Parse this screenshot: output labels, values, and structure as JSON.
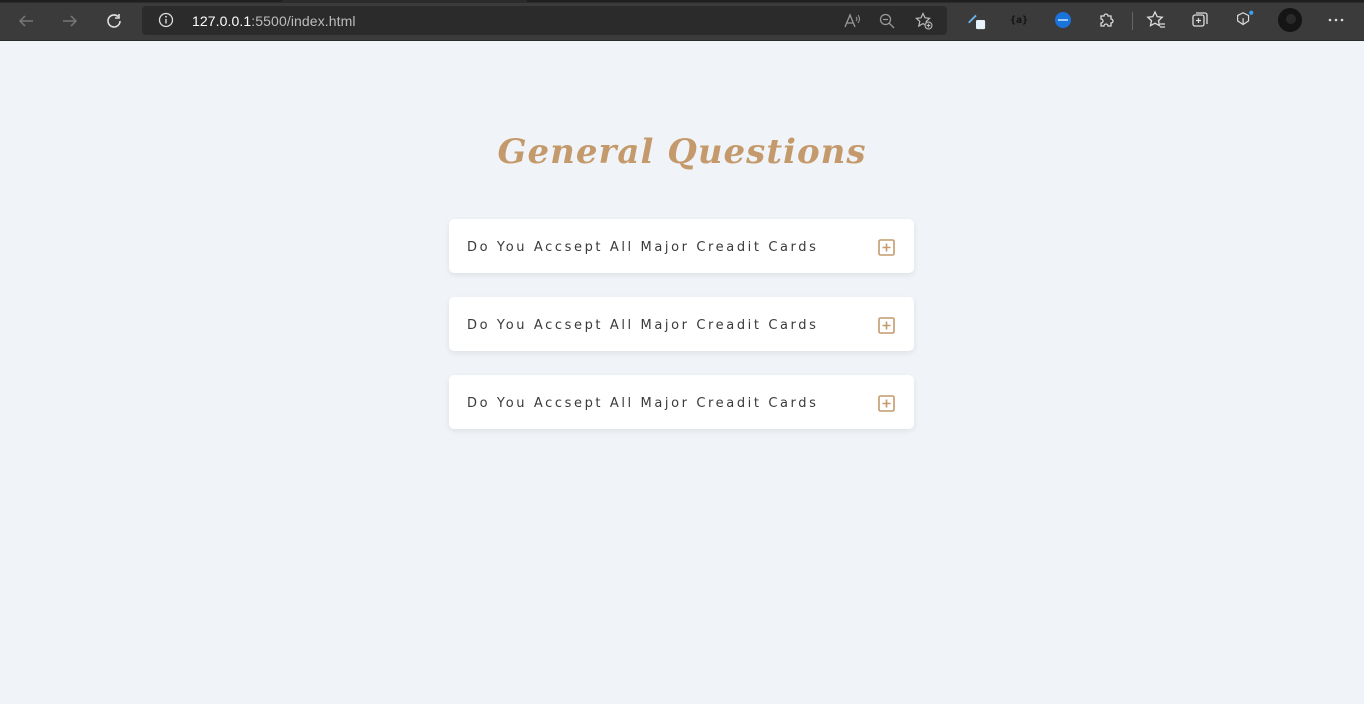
{
  "browser": {
    "url_host": "127.0.0.1",
    "url_rest": ":5500/index.html",
    "icons": [
      "back-icon",
      "forward-icon",
      "refresh-icon",
      "info-icon",
      "read-aloud-icon",
      "zoom-out-icon",
      "add-favorite-icon",
      "extension-pen-icon",
      "extension-braces-icon",
      "extension-json-icon",
      "extensions-icon",
      "favorites-icon",
      "collections-icon",
      "browser-essentials-icon",
      "profile-avatar",
      "more-menu-icon"
    ]
  },
  "page": {
    "title": "General Questions",
    "accent_color": "#c49a6c",
    "background_color": "#f0f4f8"
  },
  "faq": [
    {
      "question": "Do You Accsept All Major Creadit Cards"
    },
    {
      "question": "Do You Accsept All Major Creadit Cards"
    },
    {
      "question": "Do You Accsept All Major Creadit Cards"
    }
  ]
}
